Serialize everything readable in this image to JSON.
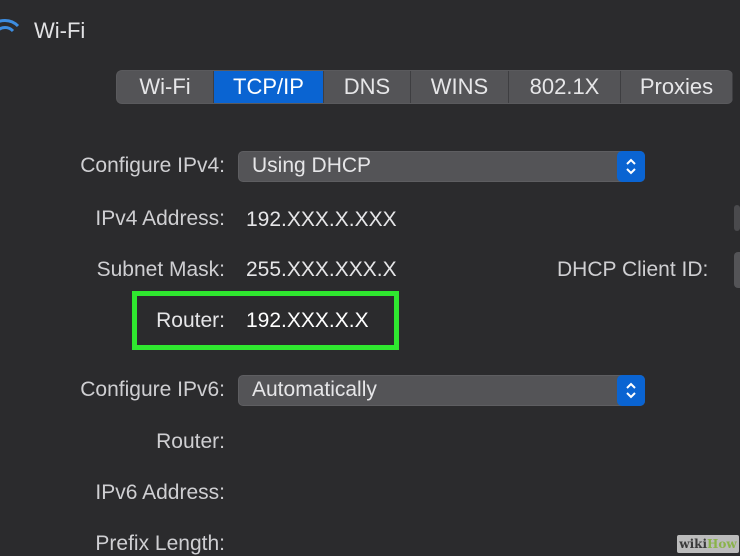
{
  "window": {
    "title": "Wi-Fi"
  },
  "tabs": [
    {
      "label": "Wi-Fi",
      "active": false
    },
    {
      "label": "TCP/IP",
      "active": true
    },
    {
      "label": "DNS",
      "active": false
    },
    {
      "label": "WINS",
      "active": false
    },
    {
      "label": "802.1X",
      "active": false
    },
    {
      "label": "Proxies",
      "active": false
    }
  ],
  "ipv4": {
    "configure_label": "Configure IPv4:",
    "configure_value": "Using DHCP",
    "address_label": "IPv4 Address:",
    "address_value": "192.XXX.X.XXX",
    "subnet_label": "Subnet Mask:",
    "subnet_value": "255.XXX.XXX.X",
    "router_label": "Router:",
    "router_value": "192.XXX.X.X",
    "dhcp_client_id_label": "DHCP Client ID:"
  },
  "ipv6": {
    "configure_label": "Configure IPv6:",
    "configure_value": "Automatically",
    "router_label": "Router:",
    "address_label": "IPv6 Address:",
    "prefix_label": "Prefix Length:"
  },
  "watermark": {
    "part1": "wiki",
    "part2": "How"
  },
  "colors": {
    "accent": "#0a64d2",
    "highlight": "#2fe82f",
    "background": "#2b2b2d"
  },
  "icons": {
    "titlebar": "wifi-icon",
    "popup_stepper": "updown-chevron-icon"
  }
}
